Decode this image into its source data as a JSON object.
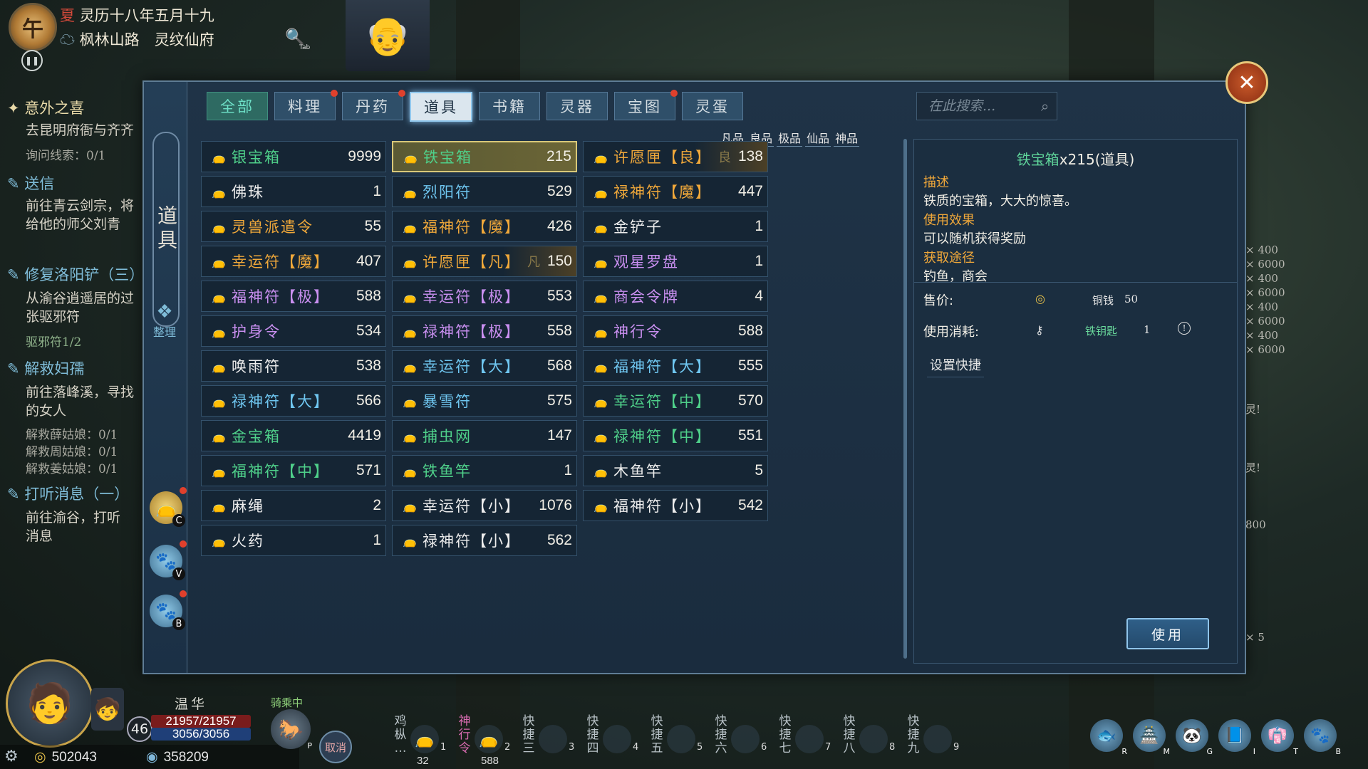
{
  "status": {
    "clock_char": "午",
    "date": "灵历十八年五月十九",
    "date_prefix": "夏",
    "location": "枫林山路　灵纹仙府",
    "search_key": "Tab"
  },
  "quests": [
    {
      "title": "意外之喜",
      "lines": [
        "去昆明府衙与齐齐",
        "询问线索：0/1"
      ]
    },
    {
      "title": "送信",
      "lines": [
        "前往青云剑宗，将",
        "给他的师父刘青"
      ]
    },
    {
      "title": "修复洛阳铲（三）",
      "lines": [
        "从渝谷逍遥居的过",
        "张驱邪符",
        "驱邪符1/2"
      ]
    },
    {
      "title": "解救妇孺",
      "lines": [
        "前往落峰溪，寻找",
        "的女人",
        "解救薛姑娘：0/1",
        "解救周姑娘：0/1",
        "解救姜姑娘：0/1"
      ]
    },
    {
      "title": "打听消息（一）",
      "lines": [
        "前往渝谷，打听",
        "消息"
      ]
    }
  ],
  "panel": {
    "side_label": "道具",
    "sort_label": "整理",
    "side_icons": [
      {
        "key": "C",
        "label": "道具",
        "active": true
      },
      {
        "key": "V",
        "label": "",
        "active": false
      },
      {
        "key": "B",
        "label": "",
        "active": false
      }
    ],
    "tabs": [
      {
        "label": "全部",
        "dot": false
      },
      {
        "label": "料理",
        "dot": true
      },
      {
        "label": "丹药",
        "dot": true
      },
      {
        "label": "道具",
        "dot": false
      },
      {
        "label": "书籍",
        "dot": false
      },
      {
        "label": "灵器",
        "dot": false
      },
      {
        "label": "宝图",
        "dot": true
      },
      {
        "label": "灵蛋",
        "dot": false
      }
    ],
    "selected_tab": "道具",
    "search_placeholder": "在此搜索...",
    "quality_legend": [
      "凡品",
      "良品",
      "极品",
      "仙品",
      "神品"
    ]
  },
  "items": [
    {
      "name": "银宝箱",
      "qty": "9999",
      "color": "#4fd08a"
    },
    {
      "name": "铁宝箱",
      "qty": "215",
      "color": "#4fd08a",
      "selected": true
    },
    {
      "name": "许愿匣【良】",
      "qty": "138",
      "color": "#f0a83a",
      "tint": "良"
    },
    {
      "name": "佛珠",
      "qty": "1",
      "color": "#ececec"
    },
    {
      "name": "烈阳符",
      "qty": "529",
      "color": "#6fc6f0"
    },
    {
      "name": "禄神符【魔】",
      "qty": "447",
      "color": "#f0a83a"
    },
    {
      "name": "灵兽派遣令",
      "qty": "55",
      "color": "#f0a83a"
    },
    {
      "name": "福神符【魔】",
      "qty": "426",
      "color": "#f0a83a"
    },
    {
      "name": "金铲子",
      "qty": "1",
      "color": "#ececec"
    },
    {
      "name": "幸运符【魔】",
      "qty": "407",
      "color": "#f0a83a"
    },
    {
      "name": "许愿匣【凡】",
      "qty": "150",
      "color": "#f0a83a",
      "tint": "凡"
    },
    {
      "name": "观星罗盘",
      "qty": "1",
      "color": "#c98ff0"
    },
    {
      "name": "福神符【极】",
      "qty": "588",
      "color": "#c98ff0"
    },
    {
      "name": "幸运符【极】",
      "qty": "553",
      "color": "#c98ff0"
    },
    {
      "name": "商会令牌",
      "qty": "4",
      "color": "#c98ff0"
    },
    {
      "name": "护身令",
      "qty": "534",
      "color": "#c98ff0"
    },
    {
      "name": "禄神符【极】",
      "qty": "558",
      "color": "#c98ff0"
    },
    {
      "name": "神行令",
      "qty": "588",
      "color": "#c98ff0"
    },
    {
      "name": "唤雨符",
      "qty": "538",
      "color": "#ececec"
    },
    {
      "name": "幸运符【大】",
      "qty": "568",
      "color": "#6fc6f0"
    },
    {
      "name": "福神符【大】",
      "qty": "555",
      "color": "#6fc6f0"
    },
    {
      "name": "禄神符【大】",
      "qty": "566",
      "color": "#6fc6f0"
    },
    {
      "name": "暴雪符",
      "qty": "575",
      "color": "#6fc6f0"
    },
    {
      "name": "幸运符【中】",
      "qty": "570",
      "color": "#4fd08a"
    },
    {
      "name": "金宝箱",
      "qty": "4419",
      "color": "#4fd08a"
    },
    {
      "name": "捕虫网",
      "qty": "147",
      "color": "#4fd08a"
    },
    {
      "name": "禄神符【中】",
      "qty": "551",
      "color": "#4fd08a"
    },
    {
      "name": "福神符【中】",
      "qty": "571",
      "color": "#4fd08a"
    },
    {
      "name": "铁鱼竿",
      "qty": "1",
      "color": "#4fd08a"
    },
    {
      "name": "木鱼竿",
      "qty": "5",
      "color": "#ececec"
    },
    {
      "name": "麻绳",
      "qty": "2",
      "color": "#ececec"
    },
    {
      "name": "幸运符【小】",
      "qty": "1076",
      "color": "#ececec"
    },
    {
      "name": "福神符【小】",
      "qty": "542",
      "color": "#ececec"
    },
    {
      "name": "火药",
      "qty": "1",
      "color": "#ececec"
    },
    {
      "name": "禄神符【小】",
      "qty": "562",
      "color": "#ececec"
    }
  ],
  "detail": {
    "title_name": "铁宝箱",
    "title_rest": "x215(道具)",
    "desc_h": "描述",
    "desc": "铁质的宝箱，大大的惊喜。",
    "effect_h": "使用效果",
    "effect": "可以随机获得奖励",
    "source_h": "获取途径",
    "source": "钓鱼，商会",
    "price_label": "售价:",
    "price_currency": "铜钱",
    "price_value": "50",
    "cost_label": "使用消耗:",
    "cost_item": "铁钥匙",
    "cost_value": "1",
    "shortcut": "设置快捷",
    "use": "使用"
  },
  "peek_right": [
    "× 400",
    "× 6000",
    "× 400",
    "× 6000",
    "× 400",
    "× 6000",
    "× 400",
    "× 6000",
    "灵!",
    "灵!",
    "800",
    "× 5"
  ],
  "hud": {
    "name": "温华",
    "level": "46",
    "hp": "21957/21957",
    "mp": "3056/3056",
    "copper": "502043",
    "silver": "358209",
    "riding": "骑乘中",
    "cancel": "取消",
    "mount_key": "P"
  },
  "hotbar": [
    {
      "label": "鸡枞…",
      "pink": false,
      "num": "1",
      "count": "32"
    },
    {
      "label": "神行令",
      "pink": true,
      "num": "2",
      "count": "588"
    },
    {
      "label": "快捷三",
      "pink": false,
      "num": "3",
      "count": ""
    },
    {
      "label": "快捷四",
      "pink": false,
      "num": "4",
      "count": ""
    },
    {
      "label": "快捷五",
      "pink": false,
      "num": "5",
      "count": ""
    },
    {
      "label": "快捷六",
      "pink": false,
      "num": "6",
      "count": ""
    },
    {
      "label": "快捷七",
      "pink": false,
      "num": "7",
      "count": ""
    },
    {
      "label": "快捷八",
      "pink": false,
      "num": "8",
      "count": ""
    },
    {
      "label": "快捷九",
      "pink": false,
      "num": "9",
      "count": ""
    }
  ],
  "right_hud_keys": [
    "R",
    "M",
    "G",
    "I",
    "T",
    "B"
  ]
}
